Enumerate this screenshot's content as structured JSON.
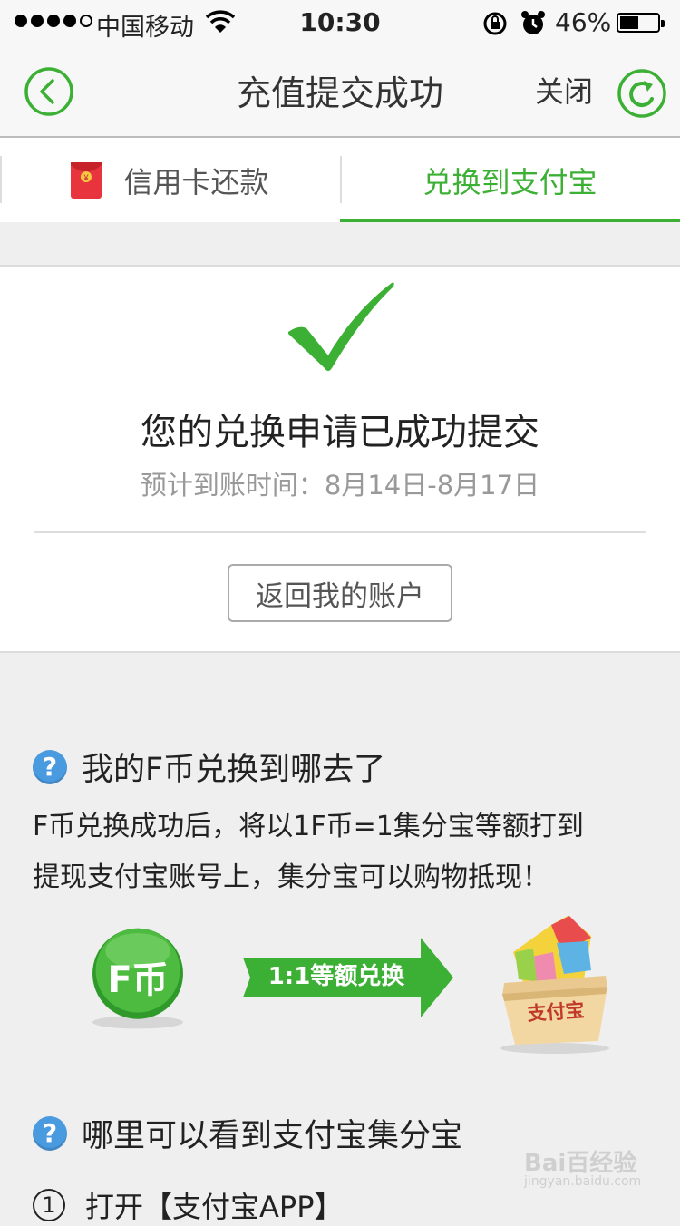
{
  "status_bar": {
    "carrier": "中国移动",
    "time": "10:30",
    "battery": "46%",
    "battery_level": 0.46
  },
  "nav": {
    "title": "充值提交成功",
    "close_label": "关闭"
  },
  "tabs": [
    {
      "label": "信用卡还款",
      "active": false
    },
    {
      "label": "兑换到支付宝",
      "active": true
    }
  ],
  "result": {
    "heading": "您的兑换申请已成功提交",
    "eta": "预计到账时间：8月14日-8月17日",
    "button_label": "返回我的账户"
  },
  "faq": {
    "q1": "我的F币兑换到哪去了",
    "a1_line1": "F币兑换成功后，将以1F币=1集分宝等额打到",
    "a1_line2": "提现支付宝账号上，集分宝可以购物抵现！",
    "q2": "哪里可以看到支付宝集分宝",
    "step1_num": "1",
    "step1_text": "打开【支付宝APP】"
  },
  "illustration": {
    "coin_label": "F币",
    "arrow_label": "1:1等额兑换",
    "box_label": "支付宝"
  },
  "watermark": {
    "line1": "Bai百经验",
    "line2": "jingyan.baidu.com"
  },
  "colors": {
    "accent_green": "#3cb034",
    "question_blue": "#4a9ae0"
  }
}
